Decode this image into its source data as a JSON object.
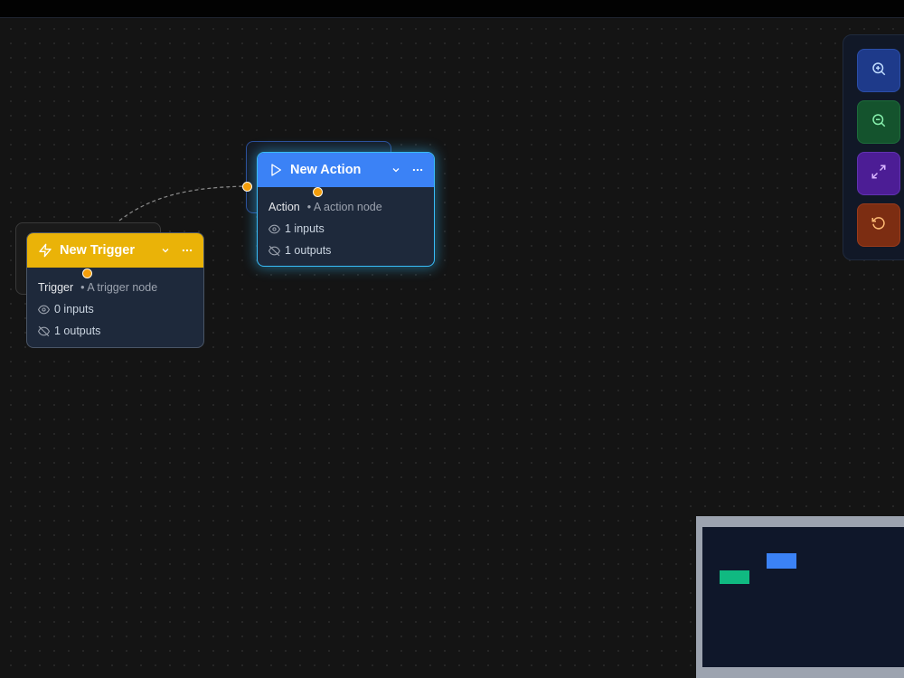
{
  "nodes": {
    "trigger": {
      "title": "New Trigger",
      "type": "Trigger",
      "description": "A trigger node",
      "inputs": "0 inputs",
      "outputs": "1 outputs",
      "header_color": "#eab308",
      "icon": "zap-icon"
    },
    "action": {
      "title": "New Action",
      "type": "Action",
      "description": "A action node",
      "inputs": "1 inputs",
      "outputs": "1 outputs",
      "header_color": "#3b82f6",
      "icon": "play-icon",
      "selected": true
    }
  },
  "controls": {
    "zoom_in": {
      "icon": "zoom-in-icon",
      "color": "#1e3a8a"
    },
    "zoom_out": {
      "icon": "zoom-out-icon",
      "color": "#14532d"
    },
    "fit_view": {
      "icon": "maximize-icon",
      "color": "#4c1d95"
    },
    "reset": {
      "icon": "rotate-ccw-icon",
      "color": "#7c2d12"
    }
  },
  "minimap": {
    "trigger_color": "#10b981",
    "action_color": "#3b82f6"
  },
  "colors": {
    "handle": "#f59e0b",
    "selection_glow": "#38bdf8",
    "canvas": "#141414"
  }
}
